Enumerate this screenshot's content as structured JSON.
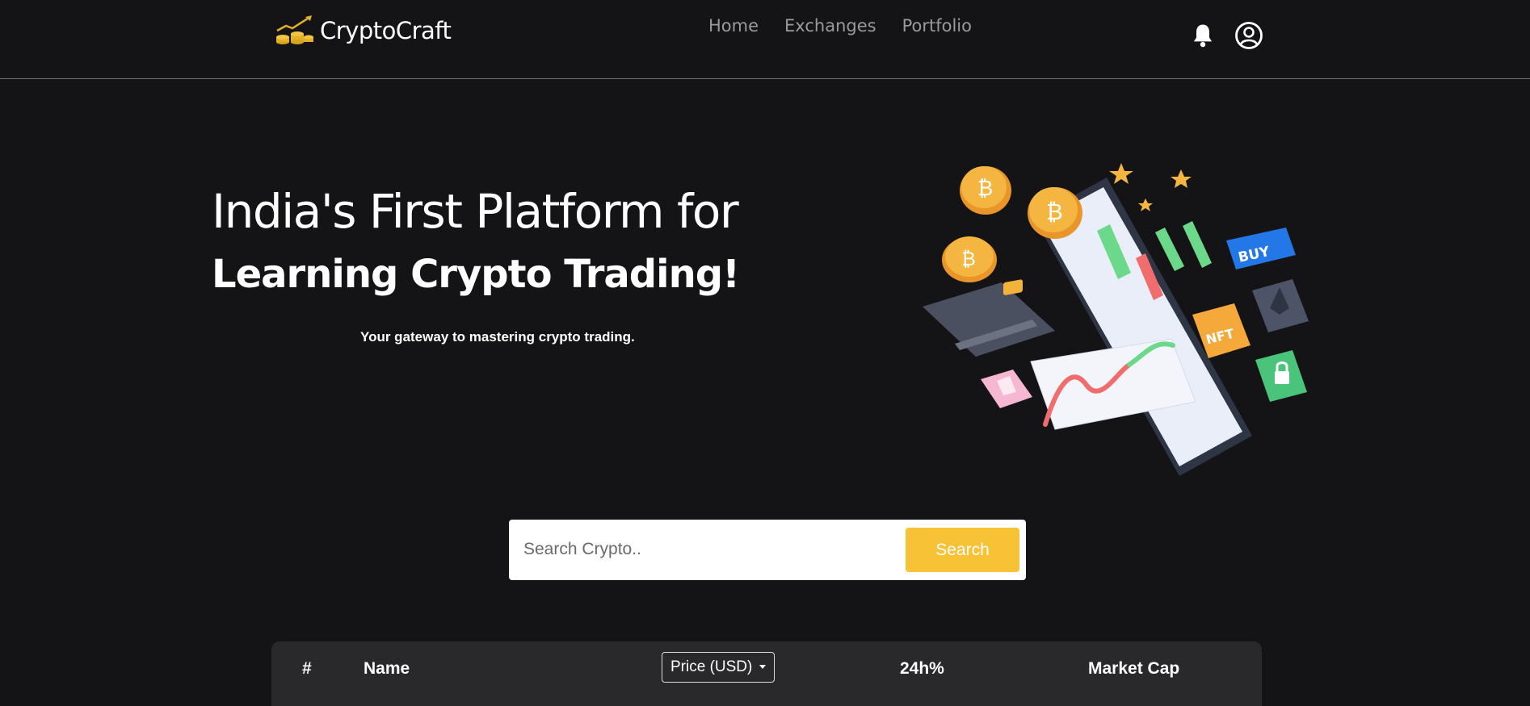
{
  "brand": {
    "name": "CryptoCraft",
    "logo_icon": "coins-chart-icon",
    "accent": "#f7c236"
  },
  "nav": {
    "items": [
      {
        "label": "Home"
      },
      {
        "label": "Exchanges"
      },
      {
        "label": "Portfolio"
      }
    ]
  },
  "header_icons": {
    "notification": "bell-icon",
    "profile": "user-circle-icon"
  },
  "hero": {
    "title_line1": "India's First Platform for",
    "title_line2": "Learning Crypto Trading!",
    "subtitle": "Your gateway to mastering crypto trading.",
    "illustration_labels": {
      "buy": "BUY",
      "nft": "NFT"
    }
  },
  "search": {
    "placeholder": "Search Crypto..",
    "button_label": "Search"
  },
  "table": {
    "columns": {
      "rank": "#",
      "name": "Name",
      "price": "Price (USD)",
      "change": "24h%",
      "market_cap": "Market Cap"
    }
  },
  "colors": {
    "background": "#141416",
    "header_row": "#29292c",
    "accent": "#f7c236"
  }
}
